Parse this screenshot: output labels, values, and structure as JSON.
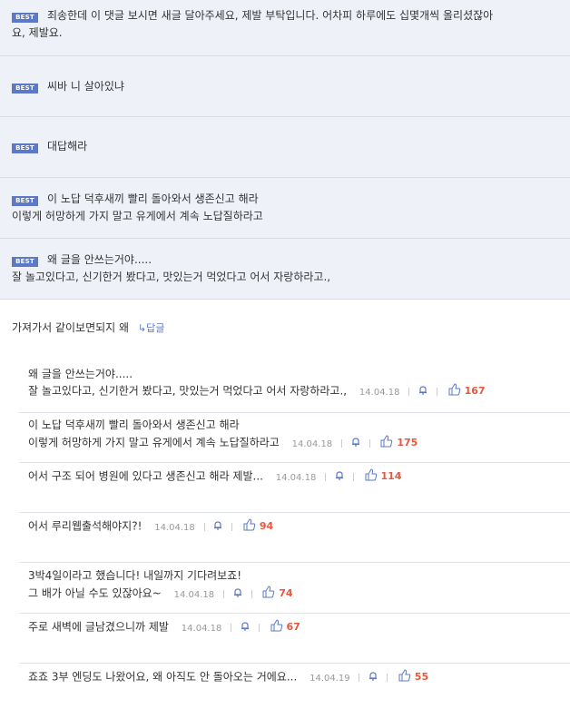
{
  "best_comments": [
    {
      "badge": "BEST",
      "lines": [
        "죄송한데 이 댓글 보시면 새글 달아주세요, 제발 부탁입니다. 어차피 하루에도 십몇개씩 올리셨잖아",
        "요, 제발요."
      ]
    },
    {
      "badge": "BEST",
      "lines": [
        "씨바 니 살아있냐"
      ]
    },
    {
      "badge": "BEST",
      "lines": [
        "대답해라"
      ]
    },
    {
      "badge": "BEST",
      "lines": [
        "이 노답 덕후새끼 빨리 돌아와서 생존신고 해라",
        "이렇게 허망하게 가지 말고 유게에서 계속 노답질하라고"
      ]
    },
    {
      "badge": "BEST",
      "lines": [
        "왜 글을 안쓰는거야.....",
        "잘 놀고있다고, 신기한거 봤다고, 맛있는거 먹었다고 어서 자랑하라고.,"
      ]
    }
  ],
  "main_comment": {
    "text": "가져가서 같이보면되지 왜",
    "reply_label": "답글",
    "reply_arrow": "↳"
  },
  "replies": [
    {
      "lines": [
        "왜 글을 안쓰는거야.....",
        "잘 놀고있다고, 신기한거 봤다고, 맛있는거 먹었다고 어서 자랑하라고.,"
      ],
      "date": "14.04.18",
      "likes": "167"
    },
    {
      "lines": [
        "이 노답 덕후새끼 빨리 돌아와서 생존신고 해라",
        "이렇게 허망하게 가지 말고 유게에서 계속 노답질하라고"
      ],
      "date": "14.04.18",
      "likes": "175"
    },
    {
      "lines": [
        "어서 구조 되어 병원에 있다고 생존신고 해라 제발..."
      ],
      "date": "14.04.18",
      "likes": "114"
    },
    {
      "lines": [
        "어서 루리웹출석해야지?!"
      ],
      "date": "14.04.18",
      "likes": "94"
    },
    {
      "lines": [
        "3박4일이라고 했습니다! 내일까지 기다려보죠!",
        "그 배가 아닐 수도 있잖아요~"
      ],
      "date": "14.04.18",
      "likes": "74"
    },
    {
      "lines": [
        "주로 새벽에 글남겼으니까 제발"
      ],
      "date": "14.04.18",
      "likes": "67"
    },
    {
      "lines": [
        "죠죠 3부 엔딩도 나왔어요, 왜 아직도 안 돌아오는 거에요..."
      ],
      "date": "14.04.19",
      "likes": "55"
    }
  ],
  "icons": {
    "alert": "bell-icon",
    "recommend": "thumbs-up-icon"
  },
  "colors": {
    "best_bg": "#eef2f8",
    "badge": "#5b79c6",
    "likes": "#e8573c",
    "date": "#999999"
  }
}
